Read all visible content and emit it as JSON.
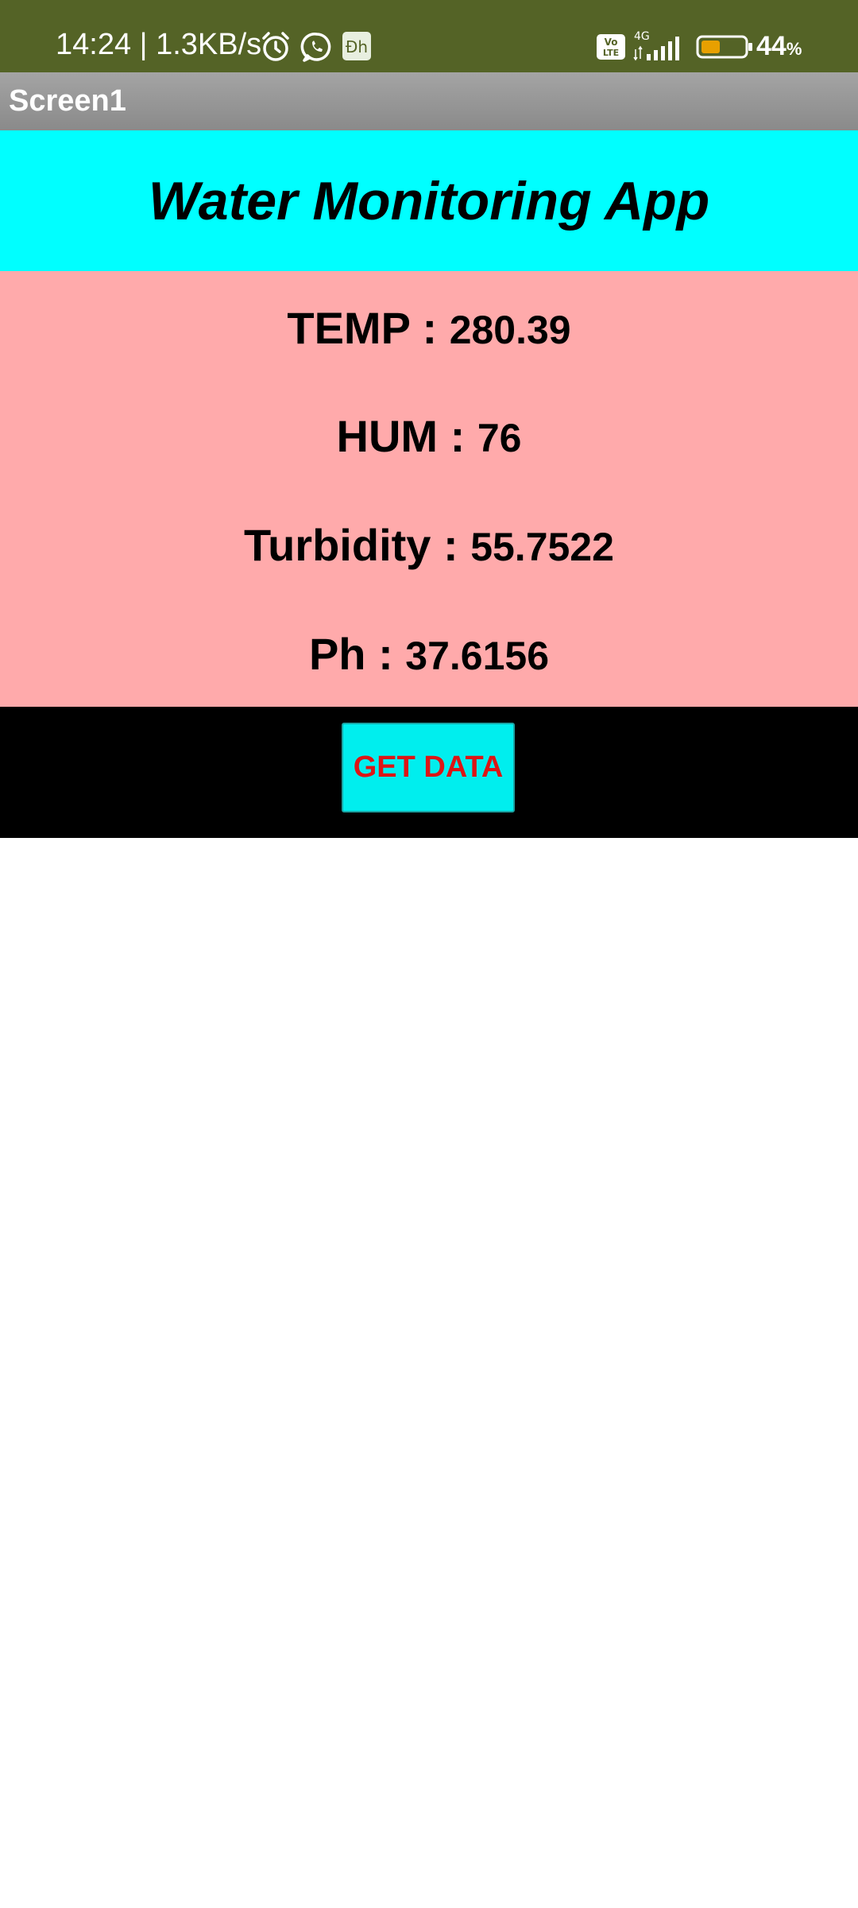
{
  "status_bar": {
    "time_speed": "14:24 | 1.3KB/s",
    "battery_value": "44",
    "battery_percent_sign": "%",
    "network_type": "4G",
    "volte_line1": "Vo",
    "volte_line2": "LTE",
    "app_icon_text": "Đh",
    "battery_level": 0.44,
    "battery_color": "#e8a000",
    "icons": [
      "alarm-icon",
      "whatsapp-icon",
      "app-icon",
      "volte-icon",
      "signal-icon",
      "battery-icon"
    ]
  },
  "title_bar": {
    "title": "Screen1"
  },
  "header": {
    "title": "Water Monitoring App"
  },
  "readings": {
    "temp_label": "TEMP : ",
    "temp_value": "280.39",
    "hum_label": "HUM : ",
    "hum_value": "76",
    "turbidity_label": "Turbidity : ",
    "turbidity_value": "55.7522",
    "ph_label": "Ph : ",
    "ph_value": "37.6156"
  },
  "actions": {
    "get_data_label": "GET DATA"
  },
  "colors": {
    "status_bar_bg": "#546326",
    "header_bg": "#00ffff",
    "readings_bg": "#ffaaab",
    "button_strip_bg": "#000000",
    "button_bg": "#00eeee",
    "button_text": "#dd1515"
  }
}
